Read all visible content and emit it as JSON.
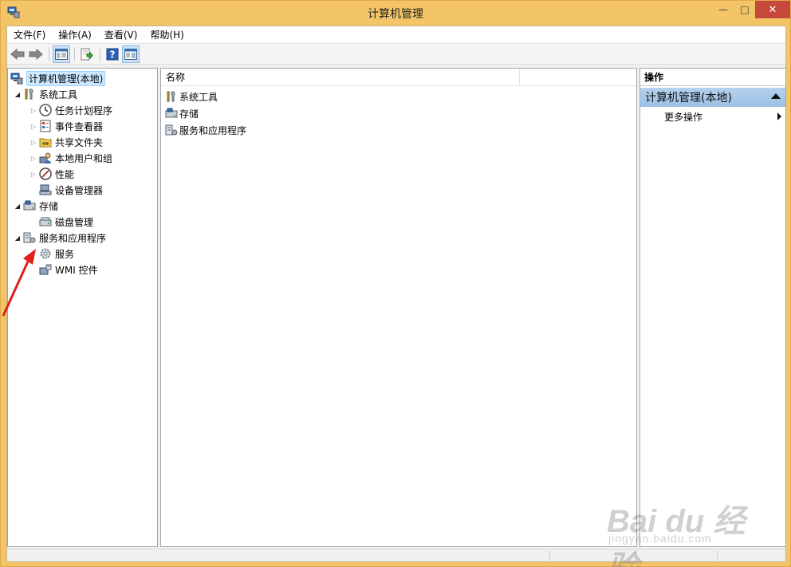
{
  "window": {
    "title": "计算机管理",
    "controls": {
      "minimize": "—",
      "maximize": "□",
      "close": "✕"
    }
  },
  "menubar": {
    "items": [
      "文件(F)",
      "操作(A)",
      "查看(V)",
      "帮助(H)"
    ]
  },
  "toolbar": {
    "buttons": [
      "back-arrow-icon",
      "forward-arrow-icon",
      "show-tree-icon",
      "export-icon",
      "help-icon",
      "show-action-pane-icon"
    ]
  },
  "tree": {
    "root": "计算机管理(本地)",
    "items": [
      {
        "label": "系统工具",
        "expander": "open",
        "icon": "tools-icon"
      },
      {
        "label": "任务计划程序",
        "expander": "closed",
        "icon": "clock-icon"
      },
      {
        "label": "事件查看器",
        "expander": "closed",
        "icon": "event-viewer-icon"
      },
      {
        "label": "共享文件夹",
        "expander": "closed",
        "icon": "shared-folder-icon"
      },
      {
        "label": "本地用户和组",
        "expander": "closed",
        "icon": "users-icon"
      },
      {
        "label": "性能",
        "expander": "closed",
        "icon": "performance-icon"
      },
      {
        "label": "设备管理器",
        "expander": "none",
        "icon": "device-manager-icon"
      },
      {
        "label": "存储",
        "expander": "open",
        "icon": "storage-icon"
      },
      {
        "label": "磁盘管理",
        "expander": "none",
        "icon": "disk-icon"
      },
      {
        "label": "服务和应用程序",
        "expander": "open",
        "icon": "services-apps-icon"
      },
      {
        "label": "服务",
        "expander": "none",
        "icon": "gear-icon"
      },
      {
        "label": "WMI 控件",
        "expander": "none",
        "icon": "wmi-icon"
      }
    ]
  },
  "list": {
    "column": "名称",
    "rows": [
      "系统工具",
      "存储",
      "服务和应用程序"
    ]
  },
  "actions": {
    "header": "操作",
    "section": "计算机管理(本地)",
    "more": "更多操作"
  },
  "watermark": {
    "main": "Bai du 经验",
    "sub": "jingyan.baidu.com"
  }
}
